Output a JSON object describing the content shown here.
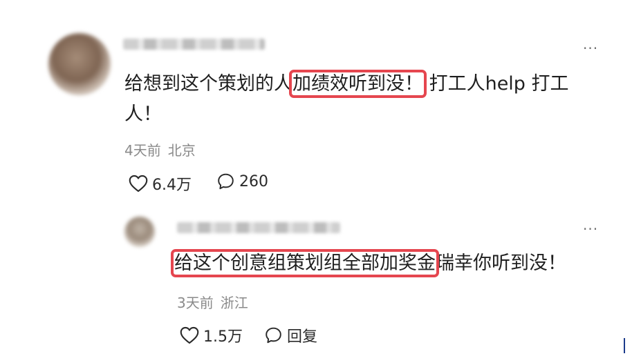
{
  "comment": {
    "text_before": "给想到这个策划的人",
    "text_highlight": "加绩效听到没！",
    "text_after_line1": " 打工人help 打工",
    "text_line2": "人！",
    "meta": {
      "time": "4天前",
      "location": "北京"
    },
    "likes": "6.4万",
    "replies": "260",
    "more": "···"
  },
  "reply": {
    "text_highlight": "给这个创意组策划组全部加奖金",
    "text_after": "瑞幸你听到没！",
    "meta": {
      "time": "3天前",
      "location": "浙江"
    },
    "likes": "1.5万",
    "reply_label": "回复",
    "more": "···"
  },
  "colors": {
    "highlight": "#e5464f",
    "meta_text": "#8a8a8a"
  }
}
